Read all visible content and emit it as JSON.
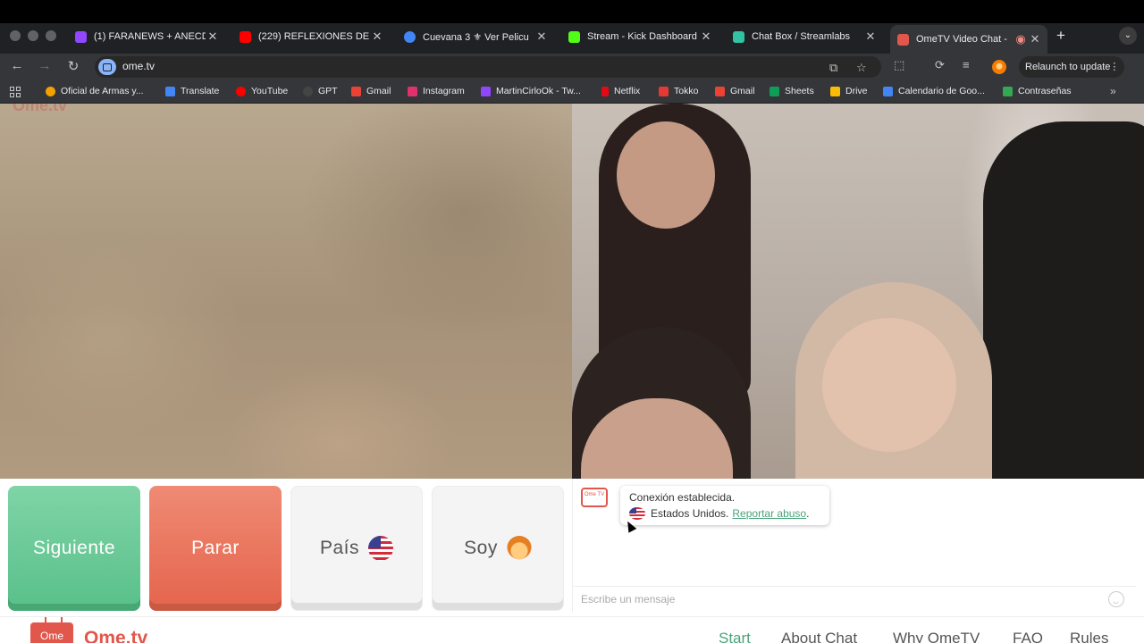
{
  "browser": {
    "tabs": [
      {
        "title": "(1) FARANEWS + ANECD",
        "favicon_color": "#9146ff"
      },
      {
        "title": "(229) REFLEXIONES DE",
        "favicon_color": "#ff0000"
      },
      {
        "title": "Cuevana 3 ⚜ Ver Pelicu",
        "favicon_color": "#4285f4"
      },
      {
        "title": "Stream - Kick Dashboard",
        "favicon_color": "#53fc18"
      },
      {
        "title": "Chat Box / Streamlabs",
        "favicon_color": "#31c3a2"
      },
      {
        "title": "OmeTV Video Chat -",
        "favicon_color": "#e2574c"
      }
    ],
    "url": "ome.tv",
    "relaunch_label": "Relaunch to update",
    "bookmarks": [
      {
        "label": "Oficial de Armas y...",
        "color": "#f4a100"
      },
      {
        "label": "Translate",
        "color": "#4285f4"
      },
      {
        "label": "YouTube",
        "color": "#ff0000"
      },
      {
        "label": "GPT",
        "color": "#444444"
      },
      {
        "label": "Gmail",
        "color": "#ea4335"
      },
      {
        "label": "Instagram",
        "color": "#e1306c"
      },
      {
        "label": "MartinCirloOk - Tw...",
        "color": "#9146ff"
      },
      {
        "label": "Netflix",
        "color": "#e50914"
      },
      {
        "label": "Tokko",
        "color": "#e53935"
      },
      {
        "label": "Gmail",
        "color": "#ea4335"
      },
      {
        "label": "Sheets",
        "color": "#0f9d58"
      },
      {
        "label": "Drive",
        "color": "#fbbc04"
      },
      {
        "label": "Calendario de Goo...",
        "color": "#4285f4"
      },
      {
        "label": "Contraseñas",
        "color": "#34a853"
      }
    ]
  },
  "controls": {
    "next_label": "Siguiente",
    "stop_label": "Parar",
    "country_label": "País",
    "gender_label": "Soy"
  },
  "chat": {
    "logo_text": "Ome TV",
    "status_line": "Conexión establecida.",
    "country_line": "Estados Unidos.",
    "report_link": "Reportar abuso",
    "input_placeholder": "Escribe un mensaje"
  },
  "footer": {
    "logo_box": "Ome",
    "logo_text": "Ome.tv",
    "nav": [
      "Start",
      "About Chat",
      "Why OmeTV",
      "FAQ",
      "Rules"
    ]
  },
  "colors": {
    "accent_green": "#59c08a",
    "accent_red": "#e5644c",
    "brand": "#e2574c"
  }
}
